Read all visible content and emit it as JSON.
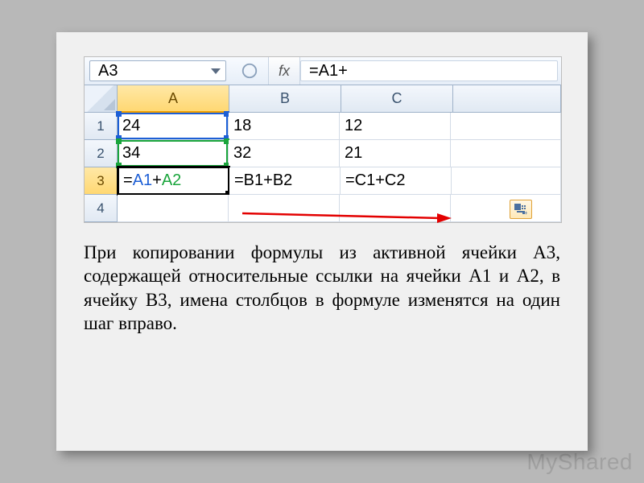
{
  "formula_bar": {
    "name_box": "A3",
    "fx_label": "fx",
    "formula_display": "=A1+"
  },
  "columns": [
    "A",
    "B",
    "C"
  ],
  "rows": [
    "1",
    "2",
    "3",
    "4"
  ],
  "cells": {
    "A1": "24",
    "B1": "18",
    "C1": "12",
    "A2": "34",
    "B2": "32",
    "C2": "21",
    "A3_prefix": "=",
    "A3_ref1": "A1",
    "A3_op": "+",
    "A3_ref2": "A2",
    "B3": "=B1+B2",
    "C3": "=C1+C2"
  },
  "active_cell": "A3",
  "selected_col": "A",
  "selected_row": "3",
  "explanation": "При копировании формулы из активной ячейки А3, содержащей относительные ссылки на ячейки А1 и А2, в ячейку В3, имена столбцов в формуле изменятся на один шаг вправо.",
  "watermark": "MyShared",
  "icons": {
    "formula_bar_left": "circle-icon",
    "autofill_options": "autofill-options-icon",
    "dropdown": "chevron-down-icon"
  }
}
